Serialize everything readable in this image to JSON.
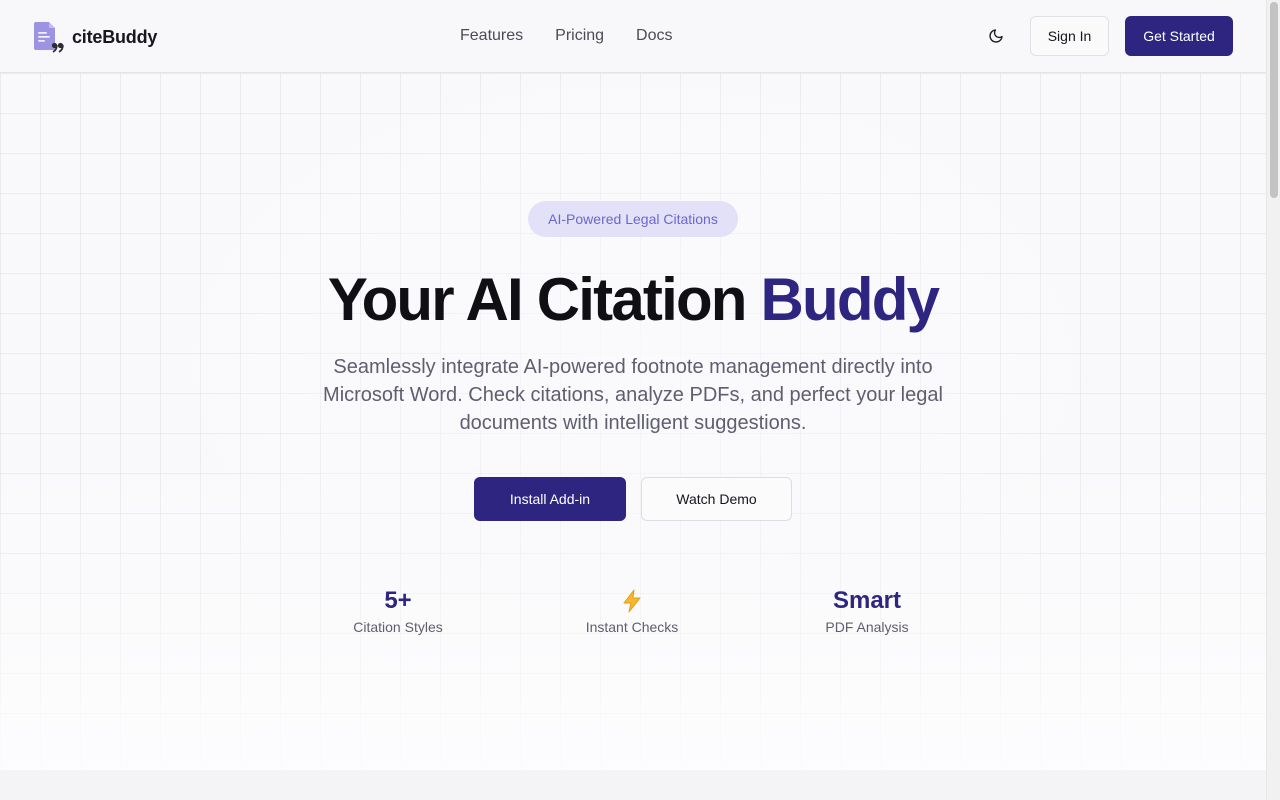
{
  "brand": {
    "name": "citeBuddy",
    "accent_color": "#2e2580"
  },
  "nav": {
    "links": [
      "Features",
      "Pricing",
      "Docs"
    ]
  },
  "header": {
    "theme_icon": "moon-icon",
    "sign_in_label": "Sign In",
    "get_started_label": "Get Started"
  },
  "hero": {
    "badge": "AI-Powered Legal Citations",
    "headline_main": "Your AI Citation",
    "headline_accent": "Buddy",
    "subtext": "Seamlessly integrate AI-powered footnote management directly into Microsoft Word. Check citations, analyze PDFs, and perfect your legal documents with intelligent suggestions.",
    "primary_cta": "Install Add-in",
    "secondary_cta": "Watch Demo"
  },
  "stats": [
    {
      "value": "5+",
      "label": "Citation Styles"
    },
    {
      "icon": "lightning-icon",
      "label": "Instant Checks"
    },
    {
      "value": "Smart",
      "label": "PDF Analysis"
    }
  ]
}
